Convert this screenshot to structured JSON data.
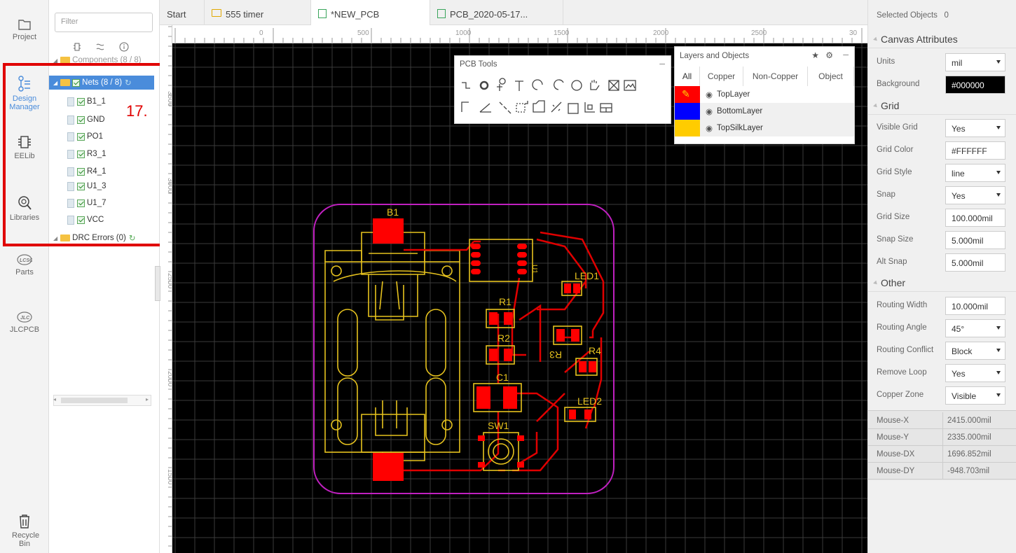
{
  "leftbar": {
    "items": [
      {
        "label": "Project",
        "icon": "folder-icon"
      },
      {
        "label": "Design Manager",
        "icon": "design-manager-icon"
      },
      {
        "label": "EELib",
        "icon": "chip-icon"
      },
      {
        "label": "Libraries",
        "icon": "search-library-icon"
      },
      {
        "label": "Parts",
        "icon": "lcsc-logo-icon"
      },
      {
        "label": "JLCPCB",
        "icon": "jlc-logo-icon"
      },
      {
        "label": "Recycle Bin",
        "icon": "trash-icon"
      }
    ]
  },
  "tree": {
    "filter_placeholder": "Filter",
    "components_label": "Components (8 / 8)",
    "nets_label": "Nets (8 / 8)",
    "nets": [
      "B1_1",
      "GND",
      "PO1",
      "R3_1",
      "R4_1",
      "U1_3",
      "U1_7",
      "VCC"
    ],
    "drc_label": "DRC Errors (0)"
  },
  "annotation": {
    "label": "17.",
    "color": "#e00000"
  },
  "tabs": [
    {
      "label": "Start"
    },
    {
      "label": "555 timer"
    },
    {
      "label": "*NEW_PCB"
    },
    {
      "label": "PCB_2020-05-17..."
    }
  ],
  "ruler": {
    "top_ticks": [
      "0",
      "500",
      "1000",
      "1500",
      "2000",
      "2500",
      "30"
    ],
    "left_ticks": [
      "3500",
      "3000",
      "2500",
      "2000",
      "1500"
    ]
  },
  "pcb": {
    "labels": {
      "b1": "B1",
      "r1": "R1",
      "r2": "R2",
      "r3": "R3",
      "r4": "R4",
      "c1": "C1",
      "led1": "LED1",
      "led2": "LED2",
      "sw1": "SW1",
      "u1": "U1"
    }
  },
  "pcb_tools": {
    "title": "PCB Tools",
    "minimize_icon": "minimize-icon"
  },
  "layers": {
    "title": "Layers and Objects",
    "tabs": [
      "All",
      "Copper",
      "Non-Copper",
      "Object"
    ],
    "rows": [
      {
        "name": "TopLayer",
        "color": "#ff0000"
      },
      {
        "name": "BottomLayer",
        "color": "#0000ff"
      },
      {
        "name": "TopSilkLayer",
        "color": "#ffcc00"
      }
    ]
  },
  "props": {
    "selected_label": "Selected Objects",
    "selected_count": "0",
    "canvas_section": "Canvas Attributes",
    "units_label": "Units",
    "units_value": "mil",
    "background_label": "Background",
    "background_value": "#000000",
    "grid_section": "Grid",
    "visible_grid_label": "Visible Grid",
    "visible_grid_value": "Yes",
    "grid_color_label": "Grid Color",
    "grid_color_value": "#FFFFFF",
    "grid_style_label": "Grid Style",
    "grid_style_value": "line",
    "snap_label": "Snap",
    "snap_value": "Yes",
    "grid_size_label": "Grid Size",
    "grid_size_value": "100.000mil",
    "snap_size_label": "Snap Size",
    "snap_size_value": "5.000mil",
    "alt_snap_label": "Alt Snap",
    "alt_snap_value": "5.000mil",
    "other_section": "Other",
    "routing_width_label": "Routing Width",
    "routing_width_value": "10.000mil",
    "routing_angle_label": "Routing Angle",
    "routing_angle_value": "45°",
    "routing_conflict_label": "Routing Conflict",
    "routing_conflict_value": "Block",
    "remove_loop_label": "Remove Loop",
    "remove_loop_value": "Yes",
    "copper_zone_label": "Copper Zone",
    "copper_zone_value": "Visible"
  },
  "mouse": {
    "x_label": "Mouse-X",
    "x_value": "2415.000mil",
    "y_label": "Mouse-Y",
    "y_value": "2335.000mil",
    "dx_label": "Mouse-DX",
    "dx_value": "1696.852mil",
    "dy_label": "Mouse-DY",
    "dy_value": "-948.703mil"
  }
}
